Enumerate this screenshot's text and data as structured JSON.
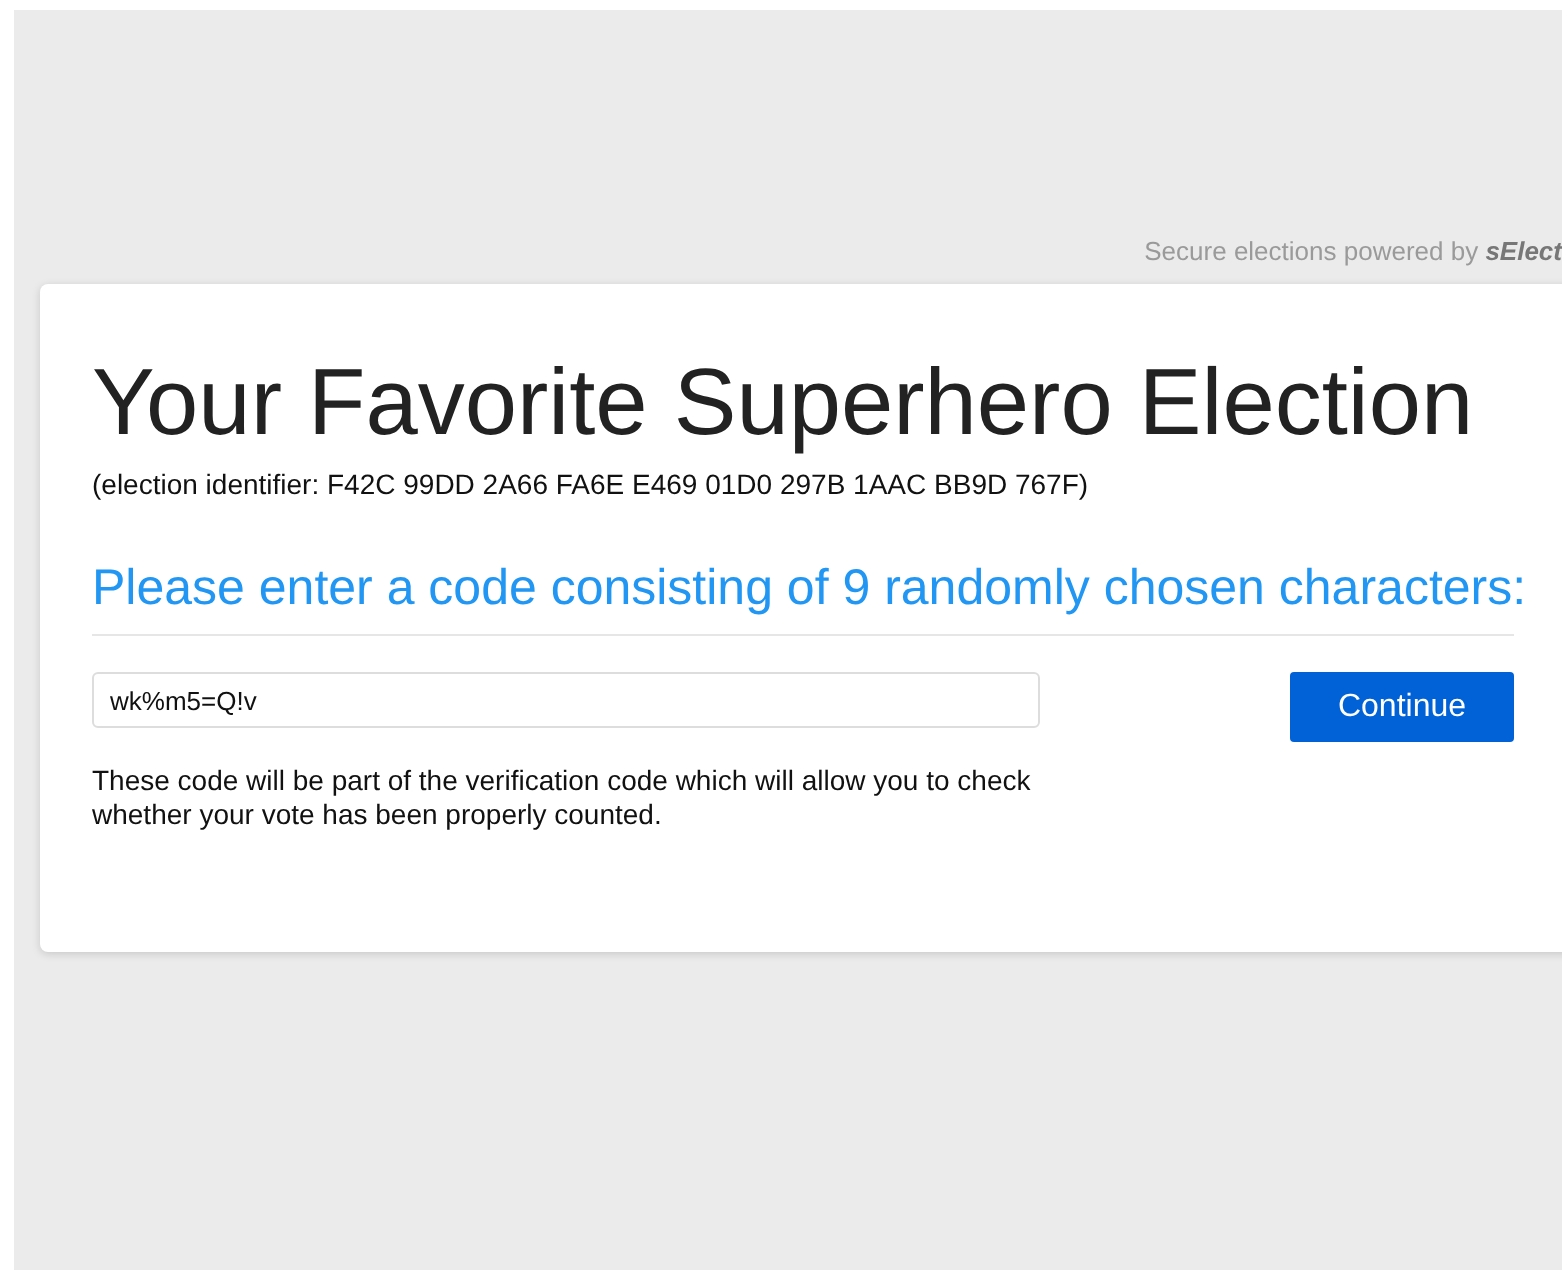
{
  "powered_by": "Secure elections powered by **sElect**",
  "election": {
    "title": "Your Favorite Superhero Election",
    "identifier": "(election identifier: F42C 99DD 2A66 FA6E E469 01D0 297B 1AAC BB9D 767F)"
  },
  "prompt": "Please enter a code consisting of 9 randomly chosen characters:",
  "code_field": {
    "value": "wk%m5=Q!v"
  },
  "continue_button": "Continue",
  "help_text": "These code will be part of the verification code which will allow you to check whether your vote has been properly counted."
}
